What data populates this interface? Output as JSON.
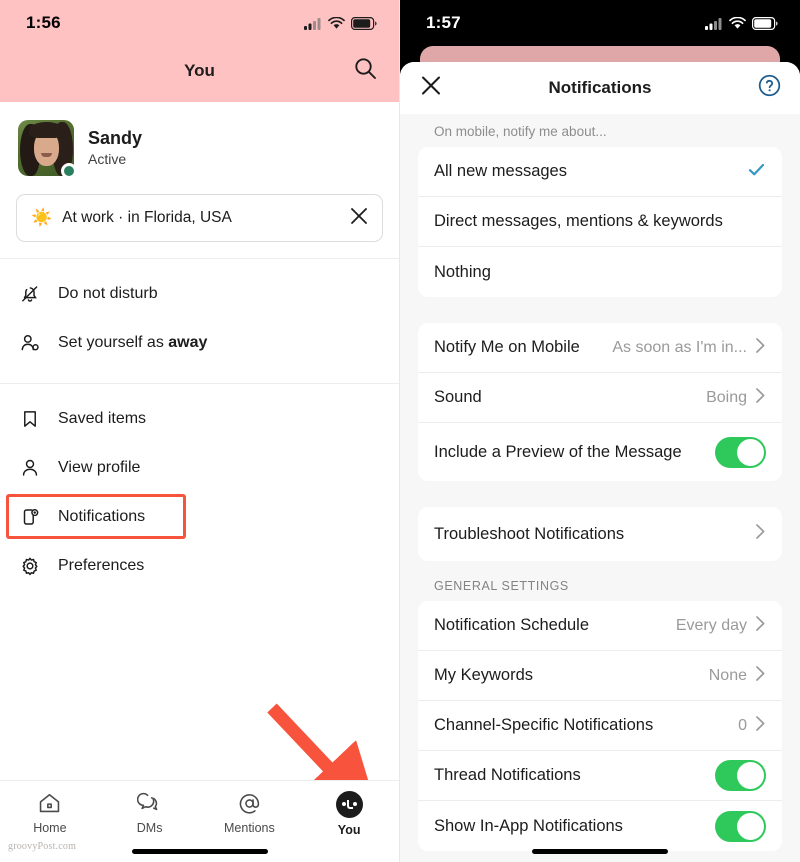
{
  "left_phone": {
    "status_bar": {
      "time": "1:56",
      "cellular": "signal-bars",
      "wifi": "wifi",
      "battery": "battery"
    },
    "nav": {
      "title": "You",
      "search_icon": "search-icon"
    },
    "profile": {
      "name": "Sandy",
      "presence_label": "Active",
      "avatar": "user-avatar",
      "presence_dot": "active-dot"
    },
    "status_pill": {
      "emoji": "☀️",
      "text": "At work · in Florida, USA",
      "clear_icon": "close-icon"
    },
    "menu": [
      {
        "icon": "bell-slash-icon",
        "label": "Do not disturb",
        "bold_suffix": ""
      },
      {
        "icon": "person-away-icon",
        "label": "Set yourself as ",
        "bold_suffix": "away"
      },
      {
        "icon": "bookmark-icon",
        "label": "Saved items",
        "bold_suffix": ""
      },
      {
        "icon": "person-icon",
        "label": "View profile",
        "bold_suffix": ""
      },
      {
        "icon": "mobile-notification-icon",
        "label": "Notifications",
        "bold_suffix": "",
        "highlighted": true
      },
      {
        "icon": "gear-icon",
        "label": "Preferences",
        "bold_suffix": ""
      }
    ],
    "tabs": [
      {
        "icon": "home-icon",
        "label": "Home",
        "active": false
      },
      {
        "icon": "dm-icon",
        "label": "DMs",
        "active": false
      },
      {
        "icon": "mention-icon",
        "label": "Mentions",
        "active": false
      },
      {
        "icon": "you-avatar-icon",
        "label": "You",
        "active": true
      }
    ],
    "watermark": "groovyPost.com",
    "annotation": {
      "arrow_color": "#f8533d",
      "target": "you-tab"
    }
  },
  "right_phone": {
    "status_bar": {
      "time": "1:57",
      "cellular": "signal-bars",
      "wifi": "wifi",
      "battery": "battery"
    },
    "sheet": {
      "title": "Notifications",
      "close_icon": "close-icon",
      "help_icon": "help-circle-icon",
      "caption": "On mobile, notify me about...",
      "notify_options": [
        {
          "label": "All new messages",
          "selected": true
        },
        {
          "label": "Direct messages, mentions & keywords",
          "selected": false
        },
        {
          "label": "Nothing",
          "selected": false
        }
      ],
      "mobile_rows": [
        {
          "label": "Notify Me on Mobile",
          "value": "As soon as I'm in...",
          "control": "chevron"
        },
        {
          "label": "Sound",
          "value": "Boing",
          "control": "chevron"
        },
        {
          "label": "Include a Preview of the Message",
          "value": "",
          "control": "toggle",
          "toggle_on": true
        }
      ],
      "troubleshoot_rows": [
        {
          "label": "Troubleshoot Notifications",
          "value": "",
          "control": "chevron"
        }
      ],
      "general_caption": "GENERAL SETTINGS",
      "general_rows": [
        {
          "label": "Notification Schedule",
          "value": "Every day",
          "control": "chevron"
        },
        {
          "label": "My Keywords",
          "value": "None",
          "control": "chevron"
        },
        {
          "label": "Channel-Specific Notifications",
          "value": "0",
          "control": "chevron"
        },
        {
          "label": "Thread Notifications",
          "value": "",
          "control": "toggle",
          "toggle_on": true
        },
        {
          "label": "Show In-App Notifications",
          "value": "",
          "control": "toggle",
          "toggle_on": true
        }
      ]
    }
  },
  "colors": {
    "pink_header": "#ffc2c2",
    "annotation_red": "#f8533d",
    "toggle_green": "#2ec95a",
    "check_blue": "#3398c6",
    "help_blue": "#1d5c8e",
    "presence_green": "#2a7f5f"
  }
}
